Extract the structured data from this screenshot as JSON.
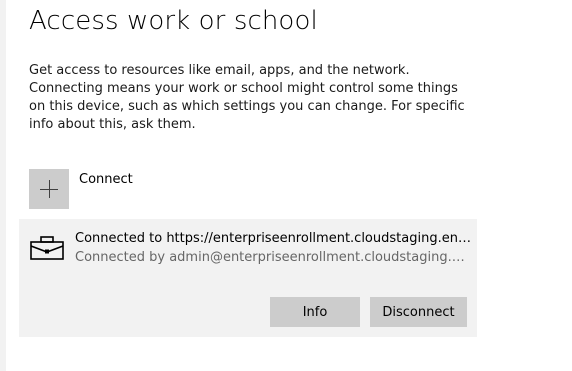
{
  "page": {
    "title": "Access work or school",
    "description": "Get access to resources like email, apps, and the network. Connecting means your work or school might control some things on this device, such as which settings you can change. For specific info about this, ask them."
  },
  "connect": {
    "icon": "plus-icon",
    "label": "Connect"
  },
  "account": {
    "icon": "briefcase-icon",
    "connected_to": "Connected to https://enterpriseenrollment.cloudstaging.entgr...",
    "connected_by": "Connected by admin@enterpriseenrollment.cloudstaging.ent...",
    "info_label": "Info",
    "disconnect_label": "Disconnect"
  },
  "colors": {
    "panel_background": "#f2f2f2",
    "button_background": "#cccccc",
    "secondary_text": "#666666"
  }
}
